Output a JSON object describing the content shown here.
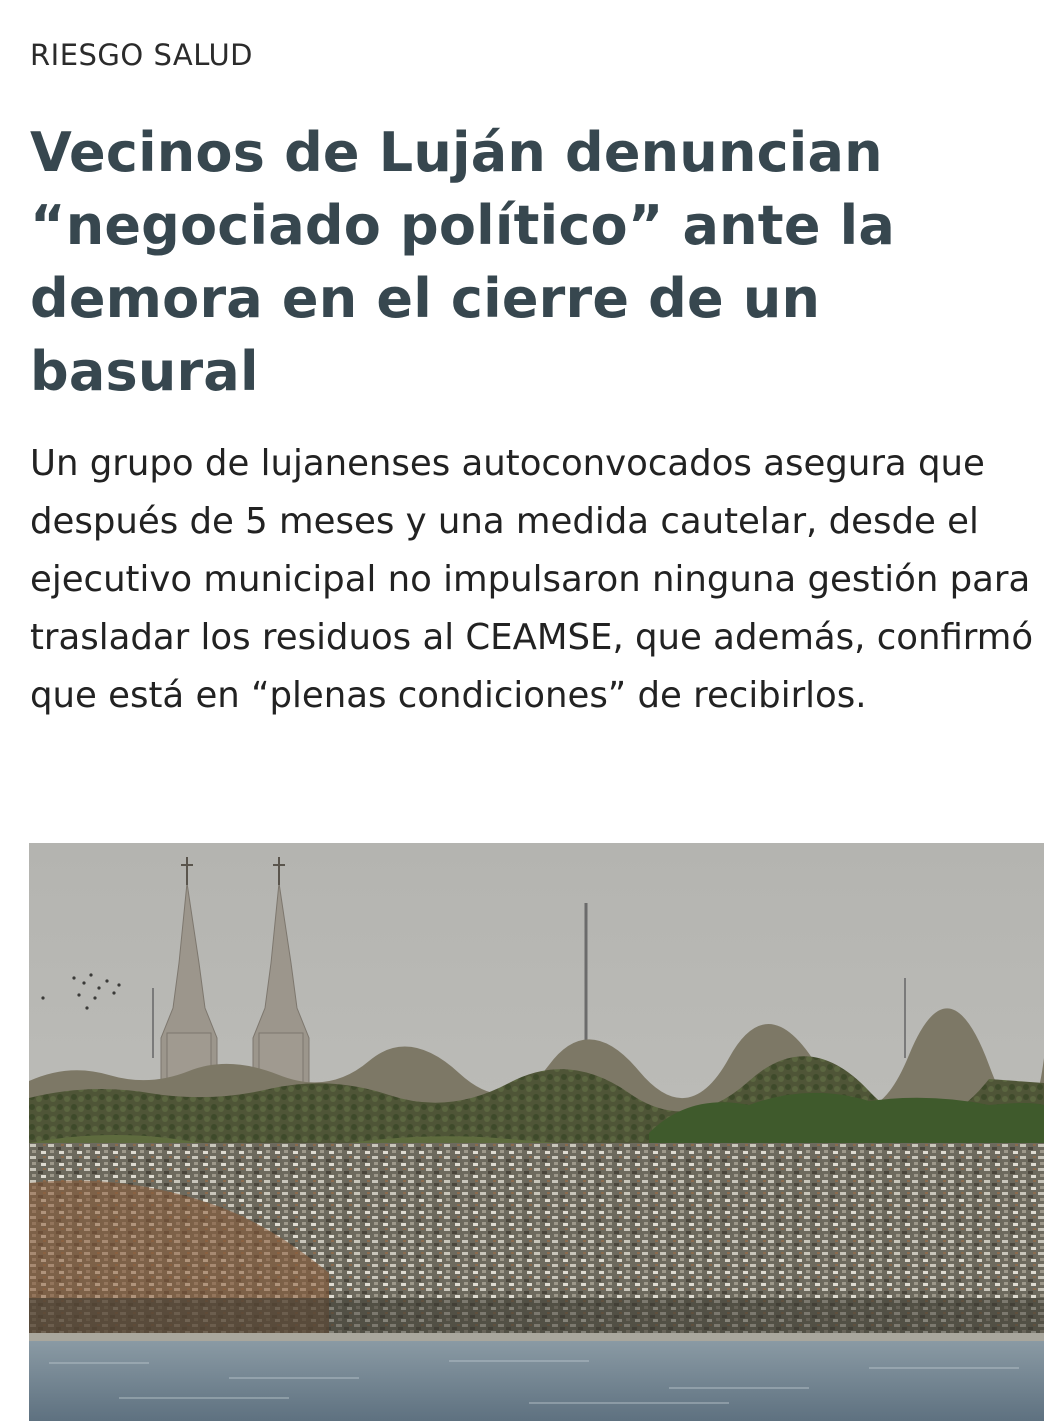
{
  "article": {
    "category": "RIESGO SALUD",
    "headline": "Vecinos de Luján denuncian “negociado político” ante la demora en el cierre de un basural",
    "lead": "Un grupo de lujanenses autoconvocados asegura que después de 5 meses y una medida cautelar, desde el ejecutivo municipal no impulsaron ninguna gestión para trasladar los residuos al CEAMSE, que además, confirmó que está en “plenas condiciones” de recibirlos."
  },
  "colors": {
    "headline": "#37474f",
    "body_text": "#222222",
    "category": "#2b2b2b"
  }
}
